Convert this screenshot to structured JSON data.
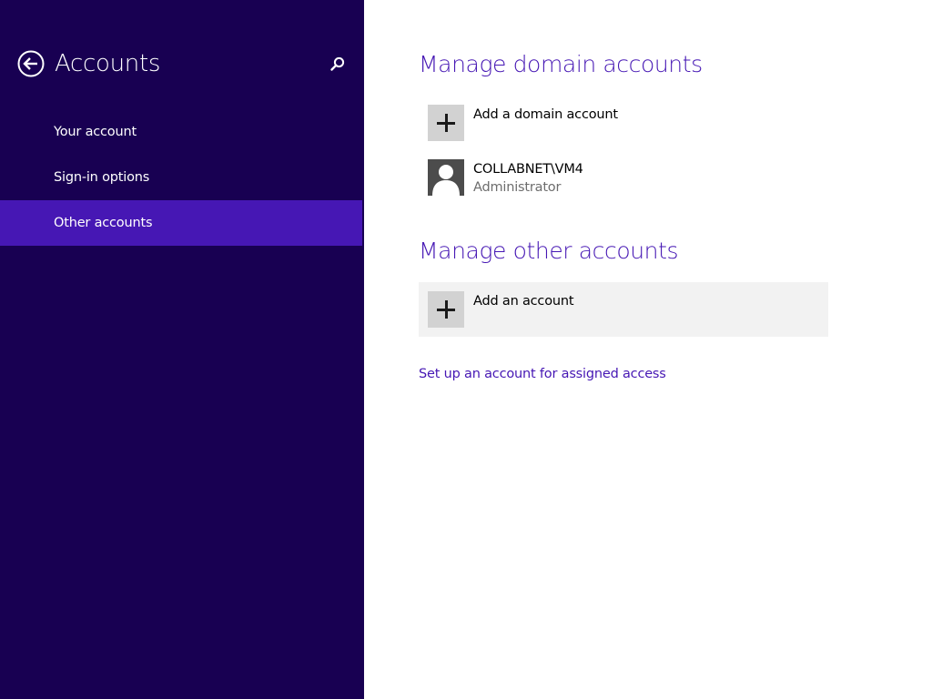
{
  "sidebar": {
    "title": "Accounts",
    "back_icon": "back-arrow-icon",
    "search_icon": "search-icon",
    "items": [
      {
        "label": "Your account"
      },
      {
        "label": "Sign-in options"
      },
      {
        "label": "Other accounts",
        "selected": true
      }
    ]
  },
  "main": {
    "domain_section": {
      "title": "Manage domain accounts",
      "add_label": "Add a domain account",
      "accounts": [
        {
          "name": "COLLABNET\\VM4",
          "role": "Administrator"
        }
      ]
    },
    "other_section": {
      "title": "Manage other accounts",
      "add_label": "Add an account"
    },
    "assigned_access_link": "Set up an account for assigned access"
  },
  "colors": {
    "sidebar_bg": "#180052",
    "accent": "#4617b4",
    "tile_bg": "#d2d2d2",
    "avatar_bg": "#4c4c4c",
    "hover_row_bg": "#f2f2f2"
  }
}
